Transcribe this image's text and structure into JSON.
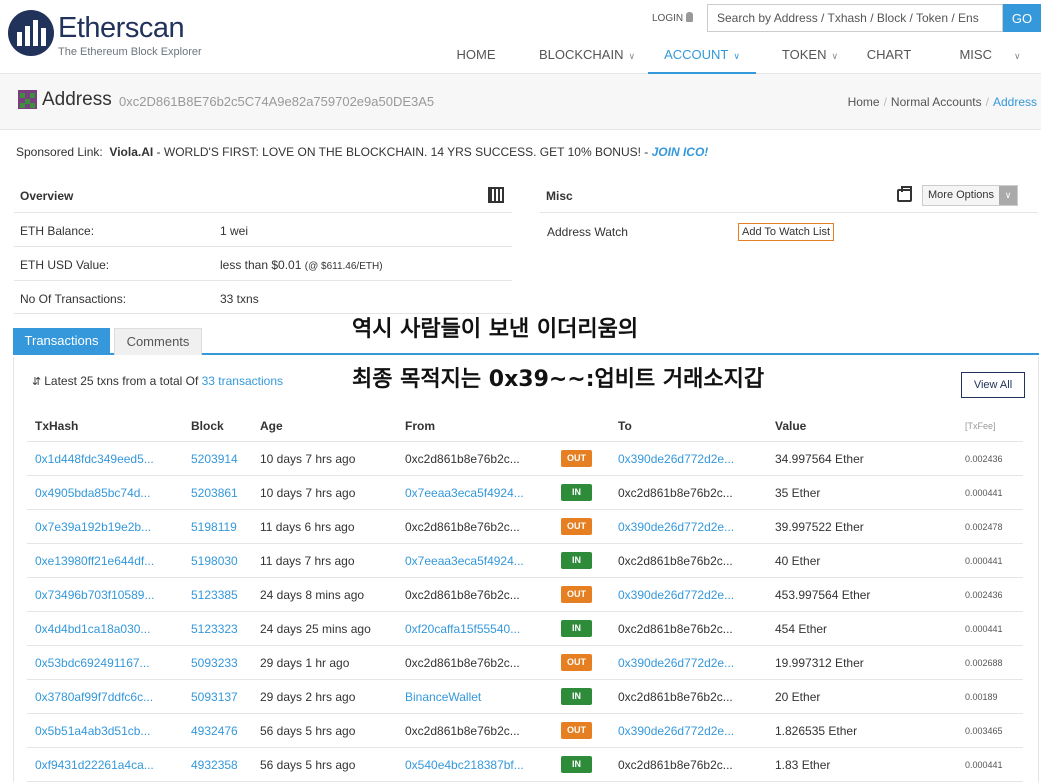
{
  "header": {
    "logo_title": "Etherscan",
    "logo_subtitle": "The Ethereum Block Explorer",
    "login": "LOGIN",
    "search_placeholder": "Search by Address / Txhash / Block / Token / Ens",
    "go": "GO",
    "nav": [
      {
        "label": "HOME",
        "dropdown": false,
        "active": false
      },
      {
        "label": "BLOCKCHAIN",
        "dropdown": true,
        "active": false
      },
      {
        "label": "ACCOUNT",
        "dropdown": true,
        "active": true
      },
      {
        "label": "TOKEN",
        "dropdown": true,
        "active": false
      },
      {
        "label": "CHART",
        "dropdown": false,
        "active": false
      },
      {
        "label": "MISC",
        "dropdown": true,
        "active": false
      }
    ]
  },
  "address": {
    "title": "Address",
    "hash": "0xc2D861B8E76b2c5C74A9e82a759702e9a50DE3A5",
    "breadcrumb": [
      "Home",
      "Normal Accounts",
      "Address"
    ]
  },
  "sponsored": {
    "label": "Sponsored Link:",
    "name": "Viola.AI",
    "text": " - WORLD'S FIRST: LOVE ON THE BLOCKCHAIN. 14 YRS SUCCESS. GET 10% BONUS! - ",
    "cta": "JOIN ICO!"
  },
  "overview": {
    "title": "Overview",
    "balance_label": "ETH Balance:",
    "balance_value": "1 wei",
    "usd_label": "ETH USD Value:",
    "usd_value": "less than $0.01",
    "usd_rate": "(@ $611.46/ETH)",
    "txcount_label": "No Of Transactions:",
    "txcount_value": "33 txns"
  },
  "misc": {
    "title": "Misc",
    "more_options": "More Options",
    "watch_label": "Address Watch",
    "watch_button": "Add To Watch List"
  },
  "tabs": {
    "transactions": "Transactions",
    "comments": "Comments"
  },
  "latest": {
    "prefix": "Latest 25 txns from a total Of ",
    "link": "33 transactions"
  },
  "view_all": "View All",
  "overlay": {
    "line1": "역시 사람들이 보낸 이더리움의",
    "line2": "최종 목적지는 0x39~~:업비트 거래소지갑"
  },
  "table": {
    "headers": {
      "txhash": "TxHash",
      "block": "Block",
      "age": "Age",
      "from": "From",
      "to": "To",
      "value": "Value",
      "fee": "[TxFee]"
    },
    "rows": [
      {
        "hash": "0x1d448fdc349eed5...",
        "block": "5203914",
        "age": "10 days 7 hrs ago",
        "from": "0xc2d861b8e76b2c...",
        "from_link": false,
        "dir": "OUT",
        "to": "0x390de26d772d2e...",
        "to_link": true,
        "value": "34.997564 Ether",
        "fee": "0.002436"
      },
      {
        "hash": "0x4905bda85bc74d...",
        "block": "5203861",
        "age": "10 days 7 hrs ago",
        "from": "0x7eeaa3eca5f4924...",
        "from_link": true,
        "dir": "IN",
        "to": "0xc2d861b8e76b2c...",
        "to_link": false,
        "value": "35 Ether",
        "fee": "0.000441"
      },
      {
        "hash": "0x7e39a192b19e2b...",
        "block": "5198119",
        "age": "11 days 6 hrs ago",
        "from": "0xc2d861b8e76b2c...",
        "from_link": false,
        "dir": "OUT",
        "to": "0x390de26d772d2e...",
        "to_link": true,
        "value": "39.997522 Ether",
        "fee": "0.002478"
      },
      {
        "hash": "0xe13980ff21e644df...",
        "block": "5198030",
        "age": "11 days 7 hrs ago",
        "from": "0x7eeaa3eca5f4924...",
        "from_link": true,
        "dir": "IN",
        "to": "0xc2d861b8e76b2c...",
        "to_link": false,
        "value": "40 Ether",
        "fee": "0.000441"
      },
      {
        "hash": "0x73496b703f10589...",
        "block": "5123385",
        "age": "24 days 8 mins ago",
        "from": "0xc2d861b8e76b2c...",
        "from_link": false,
        "dir": "OUT",
        "to": "0x390de26d772d2e...",
        "to_link": true,
        "value": "453.997564 Ether",
        "fee": "0.002436"
      },
      {
        "hash": "0x4d4bd1ca18a030...",
        "block": "5123323",
        "age": "24 days 25 mins ago",
        "from": "0xf20caffa15f55540...",
        "from_link": true,
        "dir": "IN",
        "to": "0xc2d861b8e76b2c...",
        "to_link": false,
        "value": "454 Ether",
        "fee": "0.000441"
      },
      {
        "hash": "0x53bdc692491167...",
        "block": "5093233",
        "age": "29 days 1 hr ago",
        "from": "0xc2d861b8e76b2c...",
        "from_link": false,
        "dir": "OUT",
        "to": "0x390de26d772d2e...",
        "to_link": true,
        "value": "19.997312 Ether",
        "fee": "0.002688"
      },
      {
        "hash": "0x3780af99f7ddfc6c...",
        "block": "5093137",
        "age": "29 days 2 hrs ago",
        "from": "BinanceWallet",
        "from_link": true,
        "dir": "IN",
        "to": "0xc2d861b8e76b2c...",
        "to_link": false,
        "value": "20 Ether",
        "fee": "0.00189"
      },
      {
        "hash": "0x5b51a4ab3d51cb...",
        "block": "4932476",
        "age": "56 days 5 hrs ago",
        "from": "0xc2d861b8e76b2c...",
        "from_link": false,
        "dir": "OUT",
        "to": "0x390de26d772d2e...",
        "to_link": true,
        "value": "1.826535 Ether",
        "fee": "0.003465"
      },
      {
        "hash": "0xf9431d22261a4ca...",
        "block": "4932358",
        "age": "56 days 5 hrs ago",
        "from": "0x540e4bc218387bf...",
        "from_link": true,
        "dir": "IN",
        "to": "0xc2d861b8e76b2c...",
        "to_link": false,
        "value": "1.83 Ether",
        "fee": "0.000441"
      }
    ]
  },
  "colors": {
    "accent": "#3498db",
    "out": "#e67e22",
    "in": "#2e8b3a",
    "brand": "#21325b"
  }
}
